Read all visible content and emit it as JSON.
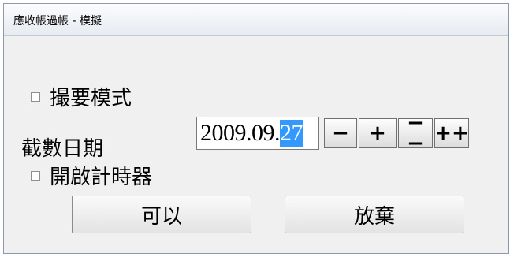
{
  "window": {
    "title": "應收帳過帳 - 模擬"
  },
  "options": {
    "summary_mode": {
      "label": "撮要模式",
      "checked": false
    },
    "enable_timer": {
      "label": "開啟計時器",
      "checked": false
    }
  },
  "cutoff": {
    "label": "截數日期",
    "date_prefix": "2009.09.",
    "date_selected": "27"
  },
  "spinners": {
    "minus": "−",
    "plus": "+",
    "minus_double": "−−",
    "plus_double": "++"
  },
  "buttons": {
    "ok": "可以",
    "cancel": "放棄"
  }
}
